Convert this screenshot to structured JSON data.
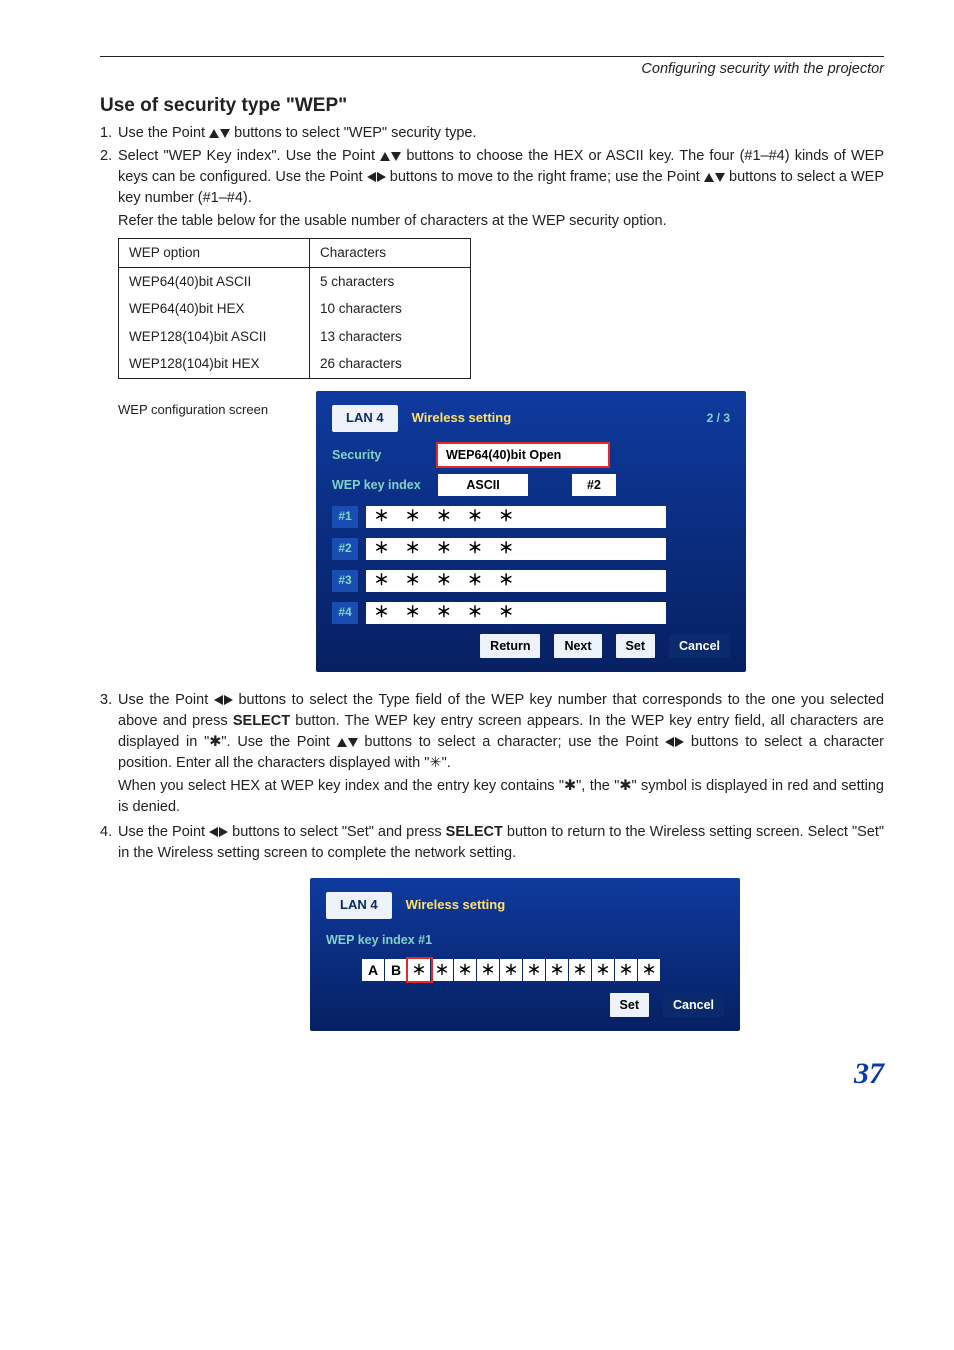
{
  "header": {
    "section_path": "Configuring security with the projector"
  },
  "title": "Use of security type \"WEP\"",
  "steps": {
    "s1": "Use the Point",
    "s1b": " buttons to select \"WEP\" security type.",
    "s2": "Select \"WEP Key index\". Use the Point",
    "s2b": " buttons to choose the HEX or ASCII key. The four (#1–#4) kinds of WEP keys can be configured. Use the Point ",
    "s2c": " buttons to move to the right frame; use the Point ",
    "s2d": " buttons to select a WEP key number (#1–#4).",
    "s2_note": "Refer the table below for the usable number of characters at the WEP security option.",
    "s3a": "Use the Point ",
    "s3b": " buttons to select the Type field of the WEP key number that corresponds to the one you selected above and press ",
    "s3c": " button. The WEP key entry screen appears. In the WEP key entry field, all characters are displayed in \"✱\". Use the Point ",
    "s3d": " buttons to select a character; use the Point ",
    "s3e": " buttons to select a character position. Enter all the characters displayed with \"✳\".",
    "s3_note": "When you select HEX at WEP key index and the entry key contains \"✱\", the \"✱\" symbol is displayed in red and setting is denied.",
    "s4a": "Use the Point ",
    "s4b": " buttons to select \"Set\" and press ",
    "s4c": " button to return to the Wireless setting screen. Select \"Set\" in the Wireless setting screen to complete the network setting."
  },
  "select_word": "SELECT",
  "wep_table": {
    "h1": "WEP option",
    "h2": "Characters",
    "rows": [
      {
        "opt": "WEP64(40)bit ASCII",
        "chars": "5 characters"
      },
      {
        "opt": "WEP64(40)bit HEX",
        "chars": "10 characters"
      },
      {
        "opt": "WEP128(104)bit ASCII",
        "chars": "13 characters"
      },
      {
        "opt": "WEP128(104)bit HEX",
        "chars": "26 characters"
      }
    ]
  },
  "caption1": "WEP configuration screen",
  "osd1": {
    "tab": "LAN 4",
    "title": "Wireless setting",
    "page": "2 / 3",
    "security_label": "Security",
    "security_value": "WEP64(40)bit Open",
    "keyindex_label": "WEP key index",
    "keyindex_mode": "ASCII",
    "keyindex_num": "#2",
    "keys": [
      {
        "tag": "#1",
        "val": "＊ ＊ ＊ ＊ ＊"
      },
      {
        "tag": "#2",
        "val": "＊ ＊ ＊ ＊ ＊"
      },
      {
        "tag": "#3",
        "val": "＊ ＊ ＊ ＊ ＊"
      },
      {
        "tag": "#4",
        "val": "＊ ＊ ＊ ＊ ＊"
      }
    ],
    "buttons": {
      "return": "Return",
      "next": "Next",
      "set": "Set",
      "cancel": "Cancel"
    }
  },
  "osd2": {
    "tab": "LAN 4",
    "title": "Wireless setting",
    "keyindex_label": "WEP key index #1",
    "cells": [
      "A",
      "B",
      "＊",
      "＊",
      "＊",
      "＊",
      "＊",
      "＊",
      "＊",
      "＊",
      "＊",
      "＊",
      "＊"
    ],
    "selected_index": 2,
    "buttons": {
      "set": "Set",
      "cancel": "Cancel"
    }
  },
  "page_number": "37"
}
